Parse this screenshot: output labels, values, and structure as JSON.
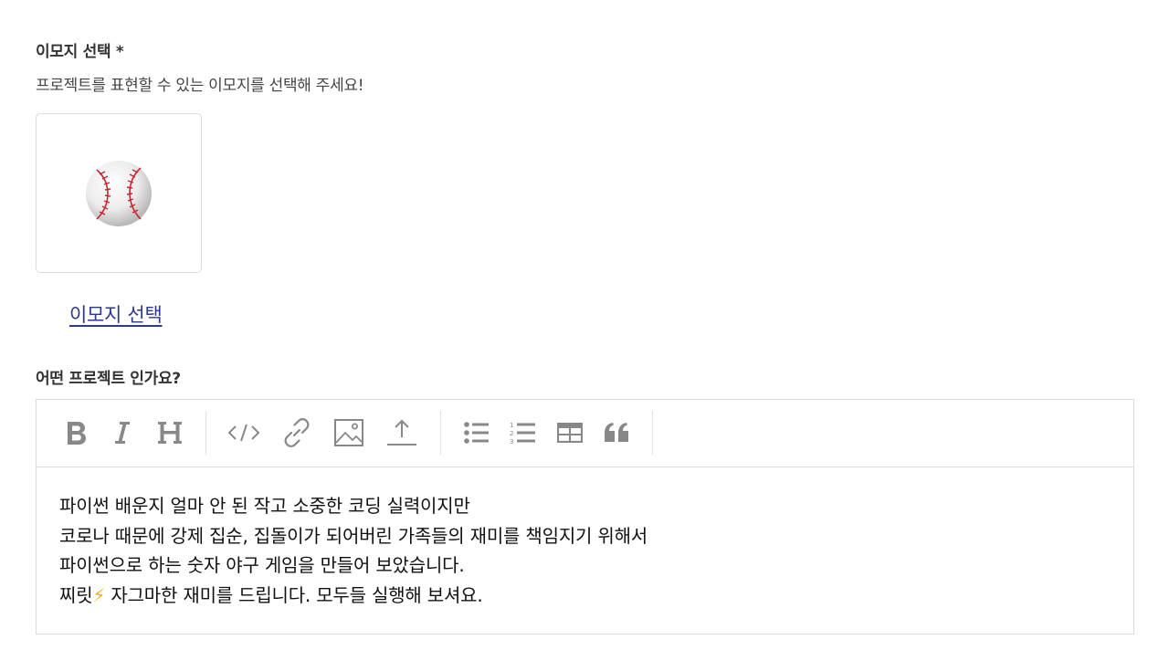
{
  "emoji_section": {
    "title": "이모지 선택 *",
    "subtitle": "프로젝트를 표현할 수 있는 이모지를 선택해 주세요!",
    "selected_emoji": "baseball-icon",
    "select_link": "이모지 선택"
  },
  "editor_section": {
    "title": "어떤 프로젝트 인가요?",
    "toolbar": {
      "icons": [
        "bold-icon",
        "italic-icon",
        "heading-icon",
        "code-icon",
        "link-icon",
        "image-icon",
        "upload-icon",
        "bullet-list-icon",
        "numbered-list-icon",
        "table-icon",
        "quote-icon"
      ],
      "icon_color": "#888888"
    },
    "content_lines": [
      "파이썬 배운지 얼마 안 된 작고 소중한 코딩 실력이지만",
      "코로나 때문에 강제 집순, 집돌이가 되어버린 가족들의 재미를 책임지기 위해서",
      "파이썬으로 하는 숫자 야구 게임을 만들어 보았습니다."
    ],
    "last_line_before_emoji": "찌릿",
    "last_line_emoji": "⚡",
    "last_line_after_emoji": " 자그마한 재미를 드립니다. 모두들 실행해 보셔요."
  },
  "colors": {
    "link": "#2c3a8c",
    "border": "#dcdcdc",
    "bolt": "#f5b400"
  }
}
